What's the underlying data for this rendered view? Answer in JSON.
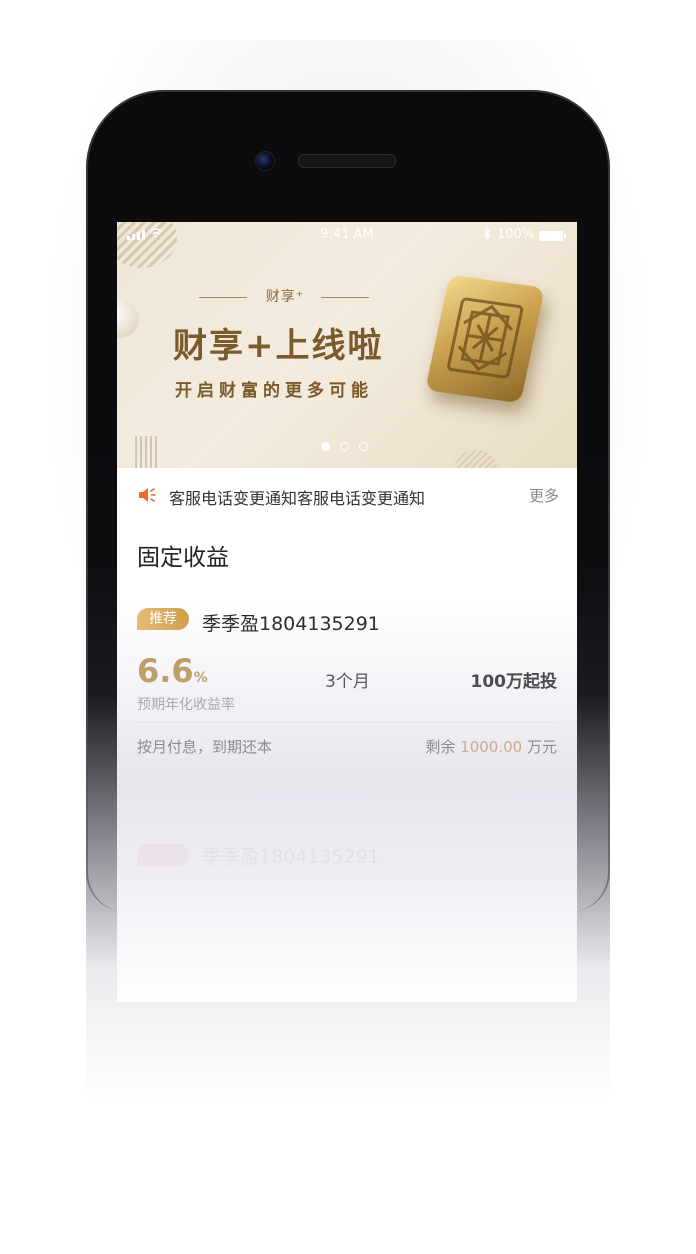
{
  "status_bar": {
    "time": "9:41 AM",
    "battery": "100%"
  },
  "banner": {
    "subtitle": "财享⁺",
    "title": "财享+上线啦",
    "tagline": "开启财富的更多可能",
    "pagination": {
      "count": 3,
      "active": 1
    }
  },
  "notice": {
    "text": "客服电话变更通知客服电话变更通知",
    "more": "更多"
  },
  "section": {
    "title": "固定收益"
  },
  "products": [
    {
      "tag": "推荐",
      "name": "季季盈1804135291",
      "rate_value": "6.6",
      "rate_unit": "%",
      "rate_label": "预期年化收益率",
      "term": "3个月",
      "min_invest": "100万起投",
      "payment": "按月付息，到期还本",
      "remaining_prefix": "剩余",
      "remaining_amount": "1000.00",
      "remaining_unit": "万元"
    },
    {
      "name": "季季盈1804135291"
    }
  ],
  "colors": {
    "accent_gold": "#b8914e",
    "tag_gradient_start": "#e6ba71",
    "tag_gradient_end": "#d09a45",
    "notice_icon": "#f26a2c"
  },
  "icons": {
    "notice": "speaker-icon",
    "status_signal": "signal-icon",
    "status_wifi": "wifi-icon",
    "status_bluetooth": "bluetooth-icon",
    "status_battery": "battery-icon"
  }
}
